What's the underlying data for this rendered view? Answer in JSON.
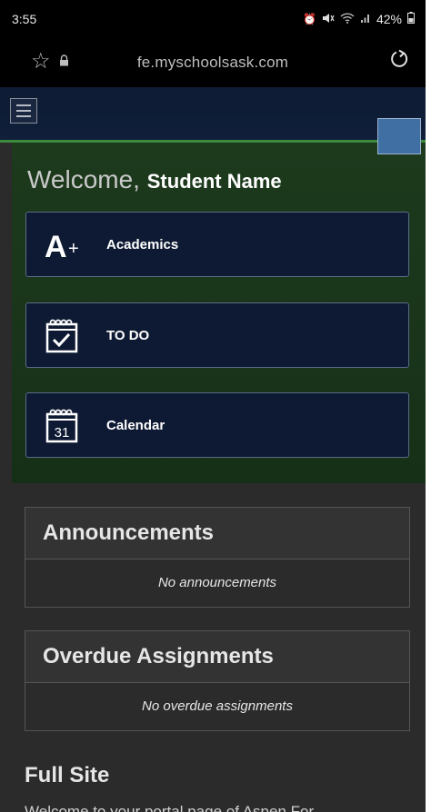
{
  "status_bar": {
    "time": "3:55",
    "battery": "42%",
    "icons": [
      "alarm-icon",
      "mute-icon",
      "wifi-icon",
      "signal-icon",
      "battery-icon"
    ]
  },
  "browser": {
    "url": "fe.myschoolsask.com",
    "icons": [
      "star-icon",
      "lock-icon",
      "reload-icon"
    ]
  },
  "header": {
    "menu_icon": "hamburger-menu-icon"
  },
  "welcome": {
    "greeting": "Welcome,",
    "name": "Student Name"
  },
  "nav_cards": [
    {
      "label": "Academics",
      "icon": "aplus-icon"
    },
    {
      "label": "TO DO",
      "icon": "todo-calendar-check-icon"
    },
    {
      "label": "Calendar",
      "icon": "calendar-31-icon",
      "icon_text": "31"
    }
  ],
  "panels": {
    "announcements": {
      "title": "Announcements",
      "empty": "No announcements"
    },
    "overdue": {
      "title": "Overdue Assignments",
      "empty": "No overdue assignments"
    }
  },
  "full_site": {
    "title": "Full Site",
    "partial_text": "Welcome to your portal page of Aspen For"
  },
  "colors": {
    "header_bg": "#0d1b33",
    "welcome_bg": "#1d3a1d",
    "card_bg": "#0e1a33",
    "accent_green": "#3b8a3e",
    "accent_blue": "#3f6fa3",
    "page_bg": "#2b2b2b"
  }
}
